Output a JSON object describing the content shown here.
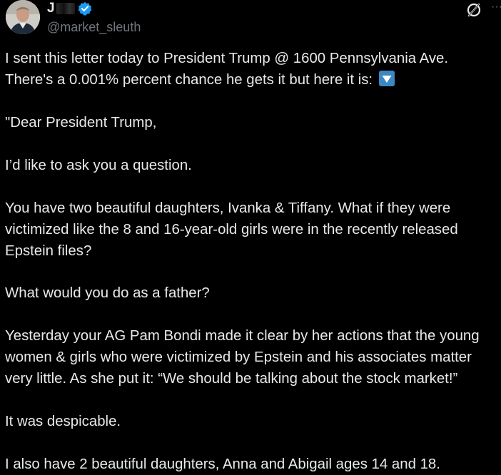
{
  "tweet": {
    "author": {
      "display_name_visible": "J",
      "handle": "@market_sleuth",
      "verified": true,
      "avatar_icon": "profile-photo"
    },
    "actions": {
      "grok_icon": "grok-icon",
      "more_icon": "more-dots-icon",
      "more_label": "···"
    },
    "lines": [
      "I sent this letter today to President Trump @ 1600 Pennsylvania Ave.",
      "There's a 0.001% percent chance he gets it but here it is:",
      "\"Dear President Trump,",
      "I’d like to ask you a question.",
      "You have two beautiful daughters, Ivanka & Tiffany. What if they were",
      "victimized like the 8 and 16-year-old girls were in the recently released",
      "Epstein files?",
      "What would you do as a father?",
      "Yesterday your AG Pam Bondi made it clear by her actions that the young",
      "women & girls who were victimized by Epstein and his associates matter",
      "very little. As she put it: “We should be talking about the stock market!”",
      "It was despicable.",
      "I also have 2 beautiful daughters, Anna and Abigail ages 14 and 18."
    ],
    "inline_emoji": "down-arrow-button-emoji",
    "colors": {
      "background": "#000000",
      "text": "#e7e9ea",
      "secondary_text": "#71767b",
      "verified_blue": "#1d9bf0",
      "emoji_blue": "#3b88c3"
    }
  }
}
